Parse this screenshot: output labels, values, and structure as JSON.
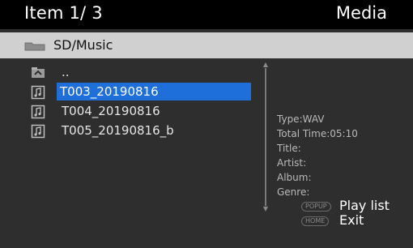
{
  "header": {
    "item_counter": "Item 1/ 3",
    "mode_title": "Media"
  },
  "pathbar": {
    "path": "SD/Music",
    "icon": "folder-icon"
  },
  "file_list": [
    {
      "label": "..",
      "icon": "parent-folder-icon",
      "selected": false
    },
    {
      "label": "T003_20190816",
      "icon": "music-file-icon",
      "selected": true
    },
    {
      "label": "T004_20190816",
      "icon": "music-file-icon",
      "selected": false
    },
    {
      "label": "T005_20190816_b",
      "icon": "music-file-icon",
      "selected": false
    }
  ],
  "info": {
    "type": "Type:WAV",
    "total_time": "Total Time:05:10",
    "title": "Title:",
    "artist": "Artist:",
    "album": "Album:",
    "genre": "Genre:"
  },
  "hints": [
    {
      "key": "POPUP",
      "label": "Play list"
    },
    {
      "key": "HOME",
      "label": "Exit"
    }
  ],
  "colors": {
    "selection": "#1e6fd9",
    "header_bg": "#000000",
    "pathbar_bg": "#d0d0d0",
    "panel_bg": "#2e2e2e"
  }
}
